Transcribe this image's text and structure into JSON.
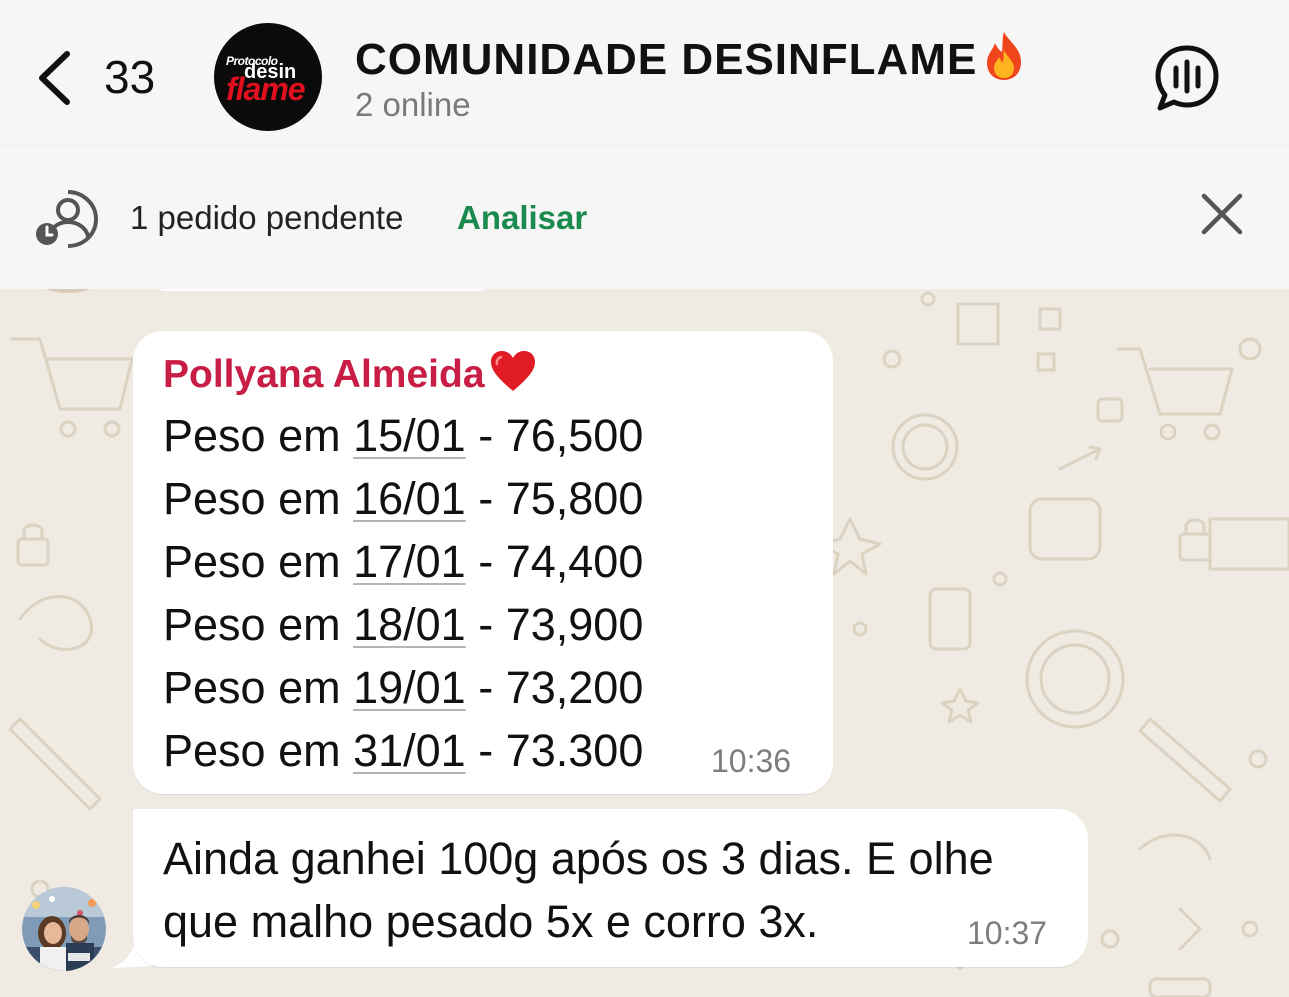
{
  "header": {
    "unread_count": "33",
    "group_title": "COMUNIDADE  DESINFLAME",
    "group_status": "2 online",
    "logo": {
      "line1": "Protocolo",
      "line2": "desin",
      "line3": "flame"
    }
  },
  "pending": {
    "text": "1 pedido pendente",
    "action": "Analisar"
  },
  "messages": [
    {
      "sender": "Pollyana Almeida",
      "lines": [
        {
          "prefix": "Peso em ",
          "date": "15/01",
          "suffix": " - 76,500"
        },
        {
          "prefix": "Peso em ",
          "date": "16/01",
          "suffix": " - 75,800"
        },
        {
          "prefix": "Peso em ",
          "date": "17/01",
          "suffix": " - 74,400"
        },
        {
          "prefix": "Peso em ",
          "date": "18/01",
          "suffix": " - 73,900"
        },
        {
          "prefix": "Peso em ",
          "date": "19/01",
          "suffix": " - 73,200"
        },
        {
          "prefix": "Peso em ",
          "date": "31/01",
          "suffix": " - 73.300"
        }
      ],
      "time": "10:36"
    },
    {
      "text_line1": "Ainda ganhei 100g após os 3 dias. E olhe",
      "text_line2": "que malho pesado 5x e corro 3x.",
      "time": "10:37"
    }
  ],
  "colors": {
    "sender_name": "#c81d45",
    "action_link": "#1b8a4e",
    "chat_background": "#efeae2"
  },
  "icons": [
    "back-chevron-icon",
    "fire-emoji-icon",
    "voice-chat-icon",
    "pending-request-icon",
    "close-icon",
    "heart-emoji-icon"
  ]
}
